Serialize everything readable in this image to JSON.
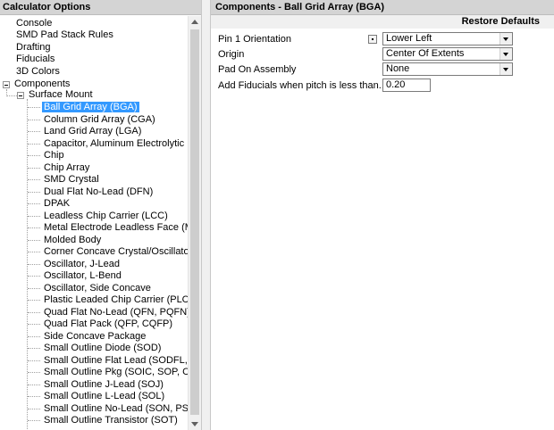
{
  "left_panel": {
    "title": "Calculator Options",
    "top_items": [
      {
        "label": "Console"
      },
      {
        "label": "SMD Pad Stack Rules"
      },
      {
        "label": "Drafting"
      },
      {
        "label": "Fiducials"
      },
      {
        "label": "3D Colors"
      }
    ],
    "components_label": "Components",
    "surface_mount_label": "Surface Mount",
    "selected_item": "Ball Grid Array (BGA)",
    "surface_mount_items": [
      {
        "label": "Ball Grid Array (BGA)"
      },
      {
        "label": "Column Grid Array (CGA)"
      },
      {
        "label": "Land Grid Array (LGA)"
      },
      {
        "label": "Capacitor, Aluminum Electrolytic"
      },
      {
        "label": "Chip"
      },
      {
        "label": "Chip Array"
      },
      {
        "label": "SMD Crystal"
      },
      {
        "label": "Dual Flat No-Lead (DFN)"
      },
      {
        "label": "DPAK"
      },
      {
        "label": "Leadless Chip Carrier (LCC)"
      },
      {
        "label": "Metal Electrode Leadless Face (MELF)"
      },
      {
        "label": "Molded Body"
      },
      {
        "label": "Corner Concave Crystal/Oscillator"
      },
      {
        "label": "Oscillator, J-Lead"
      },
      {
        "label": "Oscillator, L-Bend"
      },
      {
        "label": "Oscillator, Side Concave"
      },
      {
        "label": "Plastic Leaded Chip Carrier (PLCC)"
      },
      {
        "label": "Quad Flat No-Lead (QFN, PQFN)"
      },
      {
        "label": "Quad Flat Pack (QFP, CQFP)"
      },
      {
        "label": "Side Concave Package"
      },
      {
        "label": "Small Outline Diode (SOD)"
      },
      {
        "label": "Small Outline Flat Lead (SODFL, SOFL)"
      },
      {
        "label": "Small Outline Pkg (SOIC, SOP, CFP)"
      },
      {
        "label": "Small Outline J-Lead (SOJ)"
      },
      {
        "label": "Small Outline L-Lead (SOL)"
      },
      {
        "label": "Small Outline No-Lead (SON, PSON)"
      },
      {
        "label": "Small Outline Transistor (SOT)"
      }
    ]
  },
  "right_panel": {
    "title": "Components - Ball Grid Array (BGA)",
    "restore_label": "Restore Defaults",
    "properties": {
      "pin1": {
        "label": "Pin 1 Orientation",
        "value": "Lower Left"
      },
      "origin": {
        "label": "Origin",
        "value": "Center Of Extents"
      },
      "pad_on_assembly": {
        "label": "Pad On Assembly",
        "value": "None"
      },
      "fiducials": {
        "label": "Add Fiducials when pitch is less than...",
        "value": "0.20"
      }
    }
  },
  "colors": {
    "selection": "#3399ff",
    "header": "#d4d4d4"
  }
}
